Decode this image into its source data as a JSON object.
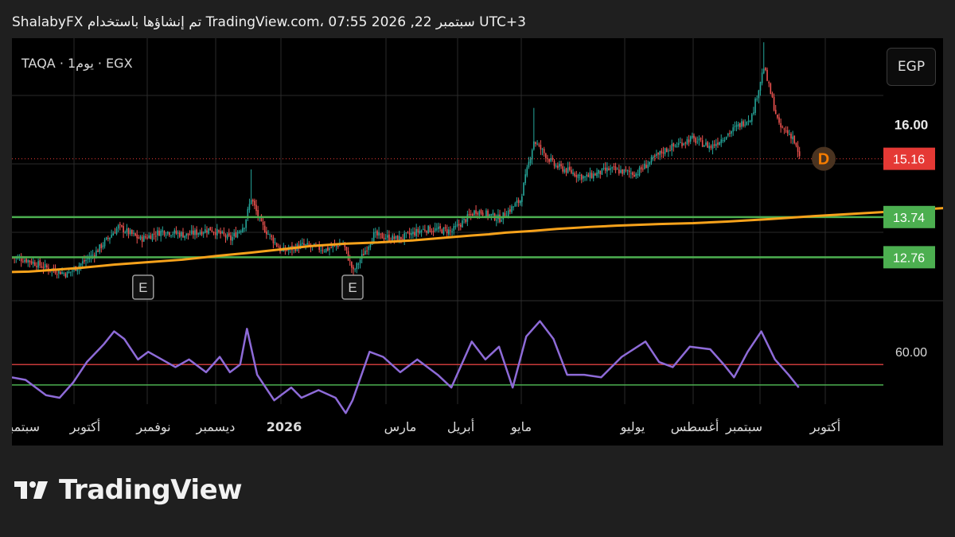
{
  "header": {
    "text": "ShalabyFX تم إنشاؤها باستخدام TradingView.com، 07:55 2026 ,22 سبتمبر UTC+3"
  },
  "symbol_label": "TAQA · 1يوم · EGX",
  "currency_button": "EGP",
  "brand": {
    "name": "TradingView"
  },
  "colors": {
    "up": "#26a69a",
    "down": "#ef5350",
    "ma": "#f7a21b",
    "support": "#4caf50",
    "rsi": "#8e6bd8",
    "rsi_upper": "#c83a3a",
    "rsi_lower": "#4caf50",
    "last_price": "#e53935"
  },
  "chart_data": [
    {
      "type": "candlestick",
      "name": "TAQA",
      "x_ticks": [
        "سبتمبر",
        "أكتوبر",
        "نوفمبر",
        "ديسمبر",
        "2026",
        "مارس",
        "أبريل",
        "مايو",
        "يوليو",
        "أغسطس",
        "سبتمبر",
        "أكتوبر"
      ],
      "y_ticks": [
        16.0
      ],
      "ylim": [
        11.7,
        18.1
      ],
      "last_price": 15.16,
      "horizontal_levels": [
        13.74,
        12.76
      ],
      "moving_average_points": [
        [
          0,
          12.4
        ],
        [
          10,
          12.41
        ],
        [
          20,
          12.44
        ],
        [
          40,
          12.5
        ],
        [
          60,
          12.58
        ],
        [
          80,
          12.64
        ],
        [
          100,
          12.7
        ],
        [
          120,
          12.79
        ],
        [
          140,
          12.87
        ],
        [
          160,
          12.96
        ],
        [
          175,
          13.03
        ],
        [
          195,
          13.09
        ],
        [
          215,
          13.12
        ],
        [
          235,
          13.17
        ],
        [
          255,
          13.24
        ],
        [
          270,
          13.29
        ],
        [
          280,
          13.32
        ],
        [
          290,
          13.36
        ],
        [
          305,
          13.4
        ],
        [
          320,
          13.45
        ],
        [
          340,
          13.5
        ],
        [
          355,
          13.53
        ],
        [
          380,
          13.57
        ],
        [
          400,
          13.59
        ],
        [
          420,
          13.63
        ],
        [
          445,
          13.69
        ],
        [
          470,
          13.76
        ],
        [
          490,
          13.81
        ],
        [
          515,
          13.87
        ],
        [
          540,
          13.94
        ],
        [
          565,
          14.0
        ],
        [
          590,
          14.08
        ],
        [
          610,
          14.16
        ],
        [
          625,
          14.25
        ],
        [
          640,
          14.35
        ],
        [
          655,
          14.48
        ],
        [
          665,
          14.57
        ],
        [
          675,
          14.63
        ]
      ],
      "events": [
        {
          "i": 77,
          "label": "E"
        },
        {
          "i": 200,
          "label": "E"
        }
      ],
      "dividend_marker": "D",
      "seed_path": [
        [
          0,
          12.75
        ],
        [
          8,
          12.7
        ],
        [
          20,
          12.5
        ],
        [
          32,
          12.35
        ],
        [
          48,
          12.85
        ],
        [
          62,
          13.5
        ],
        [
          75,
          13.2
        ],
        [
          88,
          13.4
        ],
        [
          102,
          13.3
        ],
        [
          116,
          13.45
        ],
        [
          128,
          13.2
        ],
        [
          136,
          13.55
        ],
        [
          140,
          14.2
        ],
        [
          146,
          13.55
        ],
        [
          158,
          12.9
        ],
        [
          170,
          13.05
        ],
        [
          184,
          12.95
        ],
        [
          194,
          13.1
        ],
        [
          200,
          12.4
        ],
        [
          212,
          13.3
        ],
        [
          226,
          13.2
        ],
        [
          242,
          13.45
        ],
        [
          258,
          13.4
        ],
        [
          272,
          13.9
        ],
        [
          286,
          13.7
        ],
        [
          298,
          14.15
        ],
        [
          306,
          15.6
        ],
        [
          318,
          15.0
        ],
        [
          336,
          14.7
        ],
        [
          350,
          14.9
        ],
        [
          366,
          14.8
        ],
        [
          382,
          15.35
        ],
        [
          398,
          15.65
        ],
        [
          410,
          15.45
        ],
        [
          424,
          15.9
        ],
        [
          434,
          16.2
        ],
        [
          441,
          17.4
        ],
        [
          450,
          15.95
        ],
        [
          458,
          15.7
        ],
        [
          462,
          15.16
        ]
      ]
    },
    {
      "type": "line",
      "name": "RSI",
      "y_ticks": [
        60.0
      ],
      "ylim": [
        39.5,
        80
      ],
      "bands": [
        55,
        47
      ],
      "x_positions": "same as price candles",
      "points": [
        [
          0,
          50
        ],
        [
          8,
          49
        ],
        [
          14,
          46
        ],
        [
          20,
          43
        ],
        [
          28,
          42
        ],
        [
          36,
          48
        ],
        [
          44,
          56
        ],
        [
          54,
          63
        ],
        [
          60,
          68
        ],
        [
          66,
          65
        ],
        [
          74,
          57
        ],
        [
          80,
          60
        ],
        [
          88,
          57
        ],
        [
          96,
          54
        ],
        [
          104,
          57
        ],
        [
          114,
          52
        ],
        [
          122,
          58
        ],
        [
          128,
          52
        ],
        [
          134,
          55
        ],
        [
          138,
          69
        ],
        [
          144,
          51
        ],
        [
          154,
          41
        ],
        [
          164,
          46
        ],
        [
          170,
          42
        ],
        [
          180,
          45
        ],
        [
          190,
          42
        ],
        [
          196,
          36
        ],
        [
          200,
          41
        ],
        [
          210,
          60
        ],
        [
          218,
          58
        ],
        [
          228,
          52
        ],
        [
          238,
          57
        ],
        [
          250,
          51
        ],
        [
          258,
          46
        ],
        [
          270,
          64
        ],
        [
          278,
          57
        ],
        [
          286,
          62
        ],
        [
          294,
          46
        ],
        [
          302,
          66
        ],
        [
          310,
          72
        ],
        [
          318,
          65
        ],
        [
          326,
          51
        ],
        [
          336,
          51
        ],
        [
          346,
          50
        ],
        [
          358,
          58
        ],
        [
          372,
          64
        ],
        [
          380,
          56
        ],
        [
          388,
          54
        ],
        [
          398,
          62
        ],
        [
          410,
          61
        ],
        [
          418,
          55
        ],
        [
          424,
          50
        ],
        [
          432,
          60
        ],
        [
          440,
          68
        ],
        [
          448,
          57
        ],
        [
          456,
          51
        ],
        [
          462,
          46
        ]
      ]
    }
  ]
}
